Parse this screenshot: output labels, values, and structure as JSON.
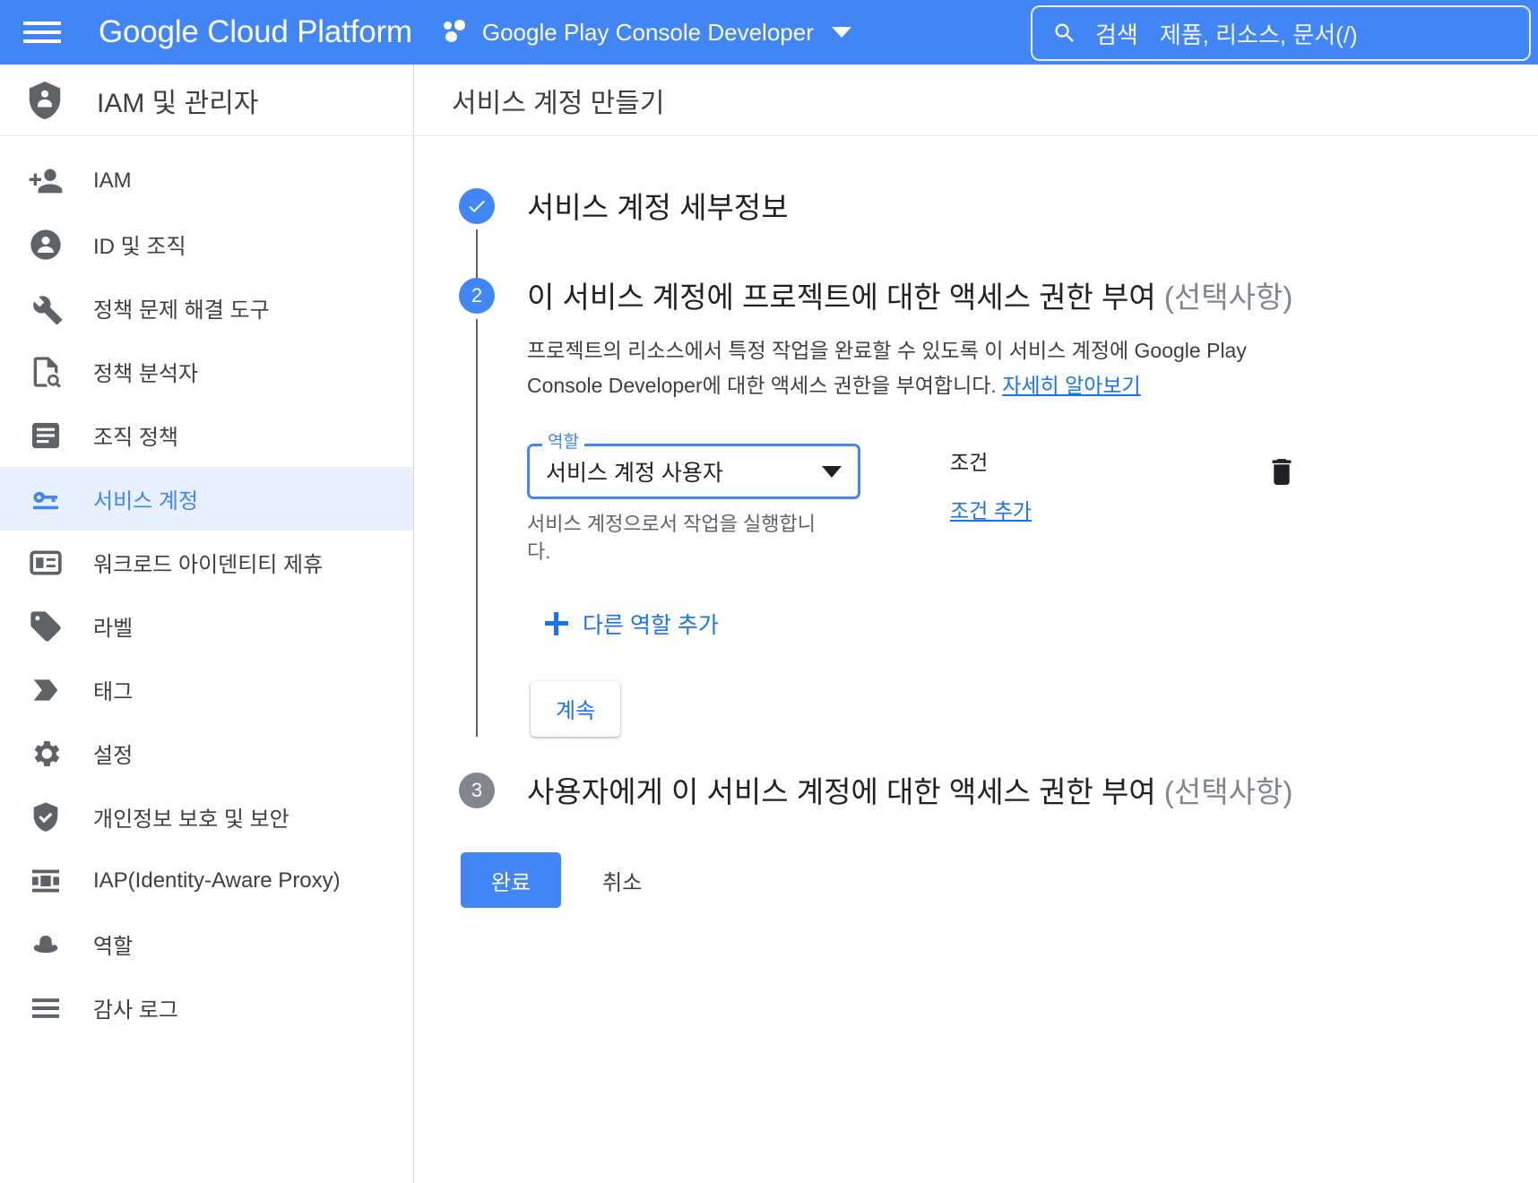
{
  "topbar": {
    "menu_icon": "hamburger-icon",
    "brand": "Google Cloud Platform",
    "project_icon": "project-dots-icon",
    "project_name": "Google Play Console Developer",
    "project_chevron": "chevron-down-icon",
    "search": {
      "icon": "search-icon",
      "label": "검색",
      "placeholder": "제품, 리소스, 문서(/)"
    }
  },
  "sidebar": {
    "header": {
      "icon": "shield-person-icon",
      "title": "IAM 및 관리자"
    },
    "items": [
      {
        "label": "IAM",
        "icon": "person-add-icon",
        "active": false
      },
      {
        "label": "ID 및 조직",
        "icon": "person-circle-icon",
        "active": false
      },
      {
        "label": "정책 문제 해결 도구",
        "icon": "wrench-icon",
        "active": false
      },
      {
        "label": "정책 분석자",
        "icon": "document-search-icon",
        "active": false
      },
      {
        "label": "조직 정책",
        "icon": "list-document-icon",
        "active": false
      },
      {
        "label": "서비스 계정",
        "icon": "key-icon",
        "active": true
      },
      {
        "label": "워크로드 아이덴티티 제휴",
        "icon": "id-card-icon",
        "active": false
      },
      {
        "label": "라벨",
        "icon": "label-tag-icon",
        "active": false
      },
      {
        "label": "태그",
        "icon": "tag-arrow-icon",
        "active": false
      },
      {
        "label": "설정",
        "icon": "gear-icon",
        "active": false
      },
      {
        "label": "개인정보 보호 및 보안",
        "icon": "shield-check-icon",
        "active": false
      },
      {
        "label": "IAP(Identity-Aware Proxy)",
        "icon": "proxy-icon",
        "active": false
      },
      {
        "label": "역할",
        "icon": "hat-icon",
        "active": false
      },
      {
        "label": "감사 로그",
        "icon": "lines-icon",
        "active": false
      }
    ]
  },
  "main": {
    "page_title": "서비스 계정 만들기",
    "steps": [
      {
        "badge": "check-icon",
        "badge_kind": "done",
        "title": "서비스 계정 세부정보",
        "title_optional": ""
      },
      {
        "badge": "2",
        "badge_kind": "active",
        "title": "이 서비스 계정에 프로젝트에 대한 액세스 권한 부여 ",
        "title_optional": "(선택사항)",
        "description_before_link": "프로젝트의 리소스에서 특정 작업을 완료할 수 있도록 이 서비스 계정에 Google Play Console Developer에 대한 액세스 권한을 부여합니다. ",
        "description_link": "자세히 알아보기",
        "role_field": {
          "legend": "역할",
          "value": "서비스 계정 사용자",
          "arrow_icon": "chevron-down-icon",
          "hint": "서비스 계정으로서 작업을 실행합니다."
        },
        "condition": {
          "label": "조건",
          "add_link": "조건 추가"
        },
        "delete_icon": "trash-icon",
        "add_role": {
          "icon": "plus-icon",
          "label": "다른 역할 추가"
        },
        "continue_button": "계속"
      },
      {
        "badge": "3",
        "badge_kind": "idle",
        "title": "사용자에게 이 서비스 계정에 대한 액세스 권한 부여 ",
        "title_optional": "(선택사항)"
      }
    ],
    "footer": {
      "done_button": "완료",
      "cancel_button": "취소"
    }
  },
  "colors": {
    "brand_blue": "#4285f4",
    "link_blue": "#1a73e8",
    "active_bg": "#e8f0fe",
    "grey_badge": "#80868b",
    "icon_grey": "#5f6368",
    "text_primary": "#202124",
    "text_secondary": "#3c4043",
    "text_muted": "#80868b"
  }
}
